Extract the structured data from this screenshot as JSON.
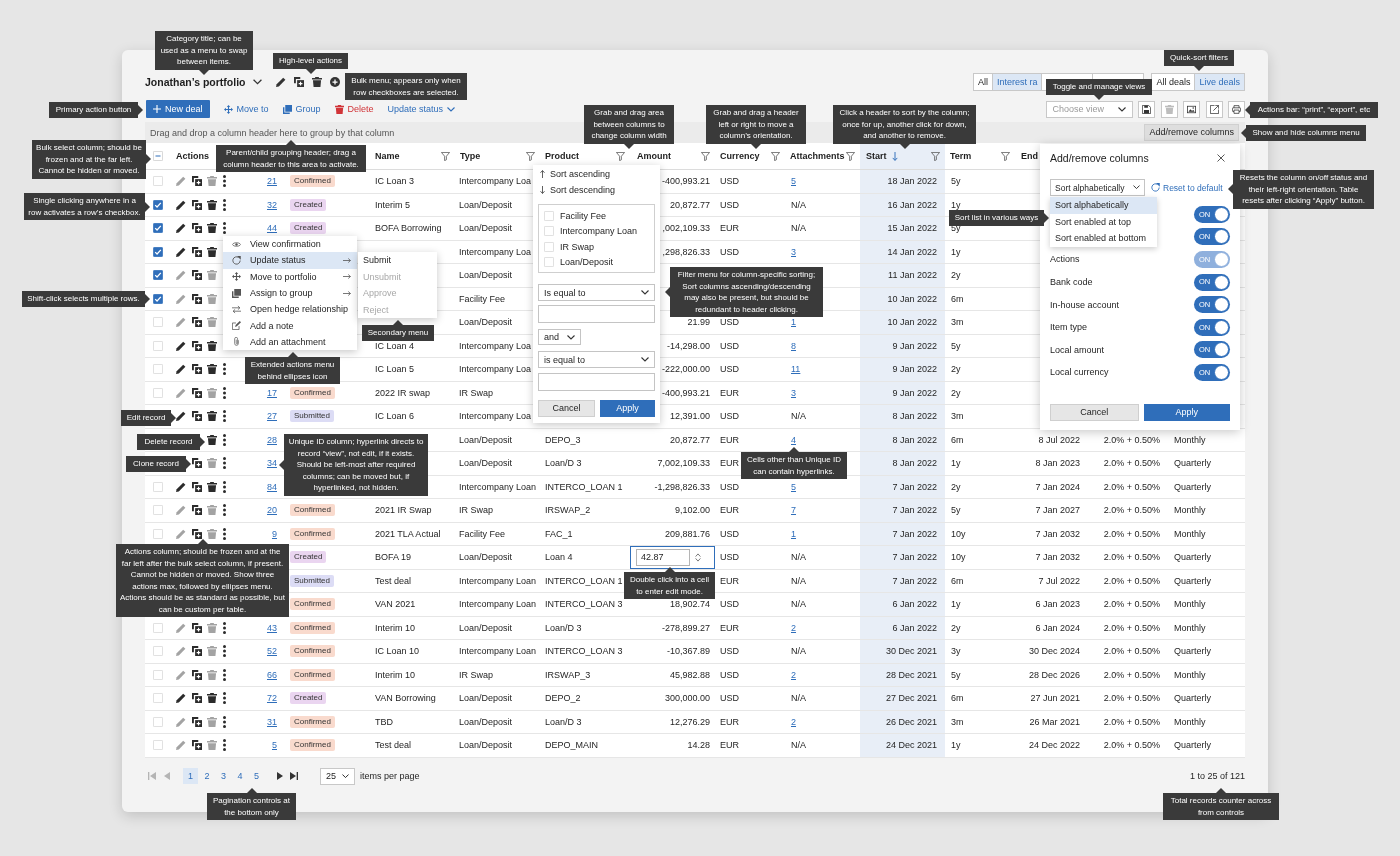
{
  "title": "Jonathan’s portfolio",
  "quick_filters": [
    {
      "segments": [
        {
          "label": "All",
          "selected": false
        },
        {
          "label": "Interest ra",
          "selected": true
        },
        {
          "selected": false
        },
        {
          "selected": false
        }
      ]
    },
    {
      "segments": [
        {
          "label": "All deals",
          "selected": false
        },
        {
          "label": "Live deals",
          "selected": true
        }
      ]
    }
  ],
  "toolbar": {
    "primary_button": "New deal",
    "bulk_actions": [
      {
        "label": "Move to",
        "kind": "move"
      },
      {
        "label": "Group",
        "kind": "group"
      },
      {
        "label": "Delete",
        "kind": "delete"
      },
      {
        "label": "Update status",
        "kind": "dropdown"
      }
    ]
  },
  "views": {
    "placeholder": "Choose view",
    "actions": [
      {
        "kind": "save",
        "disabled": false
      },
      {
        "kind": "delete",
        "disabled": true
      },
      {
        "kind": "image",
        "disabled": false
      },
      {
        "kind": "export",
        "disabled": false
      },
      {
        "kind": "print",
        "disabled": false
      }
    ]
  },
  "group_bar": {
    "hint": "Drag and drop a column header here to group by that column",
    "button": "Add/remove columns"
  },
  "table": {
    "select_all": {
      "checked": false,
      "indeterminate": true
    },
    "columns": {
      "actions": {
        "label": "Actions",
        "sorted": false
      },
      "name": {
        "label": "Name",
        "filter": true,
        "sorted": false
      },
      "type": {
        "label": "Type",
        "filter": true,
        "sorted": false
      },
      "product": {
        "label": "Product",
        "filter": true,
        "sorted": false
      },
      "amount": {
        "label": "Amount",
        "filter": true,
        "sorted": false
      },
      "currency": {
        "label": "Currency",
        "filter": true,
        "sorted": false
      },
      "attachments": {
        "label": "Attachments",
        "filter": true,
        "sorted": false
      },
      "start": {
        "label": "Start",
        "filter": true,
        "sorted": true,
        "descending": true
      },
      "term": {
        "label": "Term",
        "filter": true,
        "sorted": false
      },
      "end": {
        "label": "End",
        "sorted": false
      }
    },
    "rows": [
      {
        "checked": false,
        "locked": true,
        "actions": [
          {
            "kind": "edit"
          },
          {
            "kind": "clone"
          },
          {
            "kind": "delete"
          },
          {
            "kind": "more"
          }
        ],
        "column_3": "21",
        "column_4": {
          "label": "Confirmed",
          "color": "#f9dacd"
        },
        "name": "IC Loan 3",
        "type": "Intercompany Loa",
        "amount": "-400,993.21",
        "editing": false,
        "currency": "USD",
        "attachments": "5",
        "attachments_link": true,
        "start": "18 Jan 2022",
        "term": "5y"
      },
      {
        "checked": true,
        "locked": false,
        "actions": [
          {
            "kind": "edit"
          },
          {
            "kind": "clone"
          },
          {
            "kind": "delete"
          },
          {
            "kind": "more"
          }
        ],
        "column_3": "32",
        "column_4": {
          "label": "Created",
          "color": "#ead5f0"
        },
        "name": "Interim 5",
        "type": "Loan/Deposit",
        "amount": "20,872.77",
        "editing": false,
        "currency": "USD",
        "attachments": "N/A",
        "attachments_link": false,
        "start": "16 Jan 2022",
        "term": "1y"
      },
      {
        "checked": true,
        "locked": false,
        "actions": [
          {
            "kind": "edit"
          },
          {
            "kind": "clone"
          },
          {
            "kind": "delete"
          },
          {
            "kind": "more"
          }
        ],
        "column_3": "44",
        "column_4": {
          "label": "Created",
          "color": "#ead5f0"
        },
        "name": "BOFA Borrowing",
        "type": "Loan/Deposit",
        "amount": ",002,109.33",
        "editing": false,
        "currency": "EUR",
        "attachments": "N/A",
        "attachments_link": false,
        "start": "15 Jan 2022",
        "term": "5y"
      },
      {
        "checked": true,
        "locked": false,
        "actions": [
          {
            "kind": "edit"
          },
          {
            "kind": "clone"
          },
          {
            "kind": "delete"
          }
        ],
        "type": "Intercompany Loa",
        "amount": ",298,826.33",
        "editing": false,
        "currency": "USD",
        "attachments": "3",
        "attachments_link": true,
        "start": "14 Jan 2022",
        "term": "1y"
      },
      {
        "checked": true,
        "locked": true,
        "actions": [
          {
            "kind": "edit"
          },
          {
            "kind": "clone"
          },
          {
            "kind": "delete"
          }
        ],
        "type": "Loan/Deposit",
        "editing": false,
        "start": "11 Jan 2022",
        "term": "2y"
      },
      {
        "checked": true,
        "locked": true,
        "actions": [
          {
            "kind": "edit"
          },
          {
            "kind": "clone"
          },
          {
            "kind": "delete"
          }
        ],
        "type": "Facility Fee",
        "editing": false,
        "start": "10 Jan 2022",
        "term": "6m"
      },
      {
        "checked": false,
        "locked": true,
        "actions": [
          {
            "kind": "edit"
          },
          {
            "kind": "clone"
          },
          {
            "kind": "delete"
          }
        ],
        "type": "Loan/Deposit",
        "amount": "21.99",
        "editing": false,
        "currency": "USD",
        "attachments": "1",
        "attachments_link": true,
        "start": "10 Jan 2022",
        "term": "3m"
      },
      {
        "checked": false,
        "locked": false,
        "actions": [
          {
            "kind": "edit"
          },
          {
            "kind": "clone"
          },
          {
            "kind": "delete"
          }
        ],
        "name": "IC Loan 4",
        "type": "Intercompany Loa",
        "amount": "-14,298.00",
        "editing": false,
        "currency": "USD",
        "attachments": "8",
        "attachments_link": true,
        "start": "9 Jan 2022",
        "term": "5y"
      },
      {
        "checked": false,
        "locked": false,
        "actions": [
          {
            "kind": "edit"
          },
          {
            "kind": "clone"
          },
          {
            "kind": "delete"
          },
          {
            "kind": "more"
          }
        ],
        "name": "IC Loan 5",
        "type": "Intercompany Loa",
        "amount": "-222,000.00",
        "editing": false,
        "currency": "USD",
        "attachments": "11",
        "attachments_link": true,
        "start": "9 Jan 2022",
        "term": "2y"
      },
      {
        "checked": false,
        "locked": true,
        "actions": [
          {
            "kind": "edit"
          },
          {
            "kind": "clone"
          },
          {
            "kind": "delete"
          },
          {
            "kind": "more"
          }
        ],
        "column_3": "17",
        "column_4": {
          "label": "Confirmed",
          "color": "#f9dacd"
        },
        "name": "2022 IR swap",
        "type": "IR Swap",
        "amount": "-400,993.21",
        "editing": false,
        "currency": "EUR",
        "attachments": "3",
        "attachments_link": true,
        "start": "9 Jan 2022",
        "term": "2y"
      },
      {
        "locked": false,
        "actions": [
          {
            "kind": "edit"
          },
          {
            "kind": "clone"
          },
          {
            "kind": "delete"
          },
          {
            "kind": "more"
          }
        ],
        "column_3": "27",
        "column_4": {
          "label": "Submitted",
          "color": "#dcdcf5"
        },
        "name": "IC Loan 6",
        "type": "Intercompany Loa",
        "amount": "12,391.00",
        "editing": false,
        "currency": "USD",
        "attachments": "N/A",
        "attachments_link": false,
        "start": "8 Jan 2022",
        "term": "3m"
      },
      {
        "locked": false,
        "actions": [
          {
            "kind": "delete"
          },
          {
            "kind": "more"
          }
        ],
        "column_3": "28",
        "type": "Loan/Deposit",
        "product": "DEPO_3",
        "amount": "20,872.77",
        "editing": false,
        "currency": "EUR",
        "attachments": "4",
        "attachments_link": true,
        "start": "8 Jan 2022",
        "term": "6m",
        "end": "8 Jul 2022",
        "column_14": "2.0% + 0.50%",
        "column_15": "Monthly"
      },
      {
        "locked": true,
        "actions": [
          {
            "kind": "clone"
          },
          {
            "kind": "delete"
          },
          {
            "kind": "more"
          }
        ],
        "column_3": "34",
        "type": "Loan/Deposit",
        "product": "Loan/D 3",
        "amount": "7,002,109.33",
        "editing": false,
        "currency": "EUR",
        "start": "8 Jan 2022",
        "term": "1y",
        "end": "8 Jan 2023",
        "column_14": "2.0% + 0.50%",
        "column_15": "Quarterly"
      },
      {
        "checked": false,
        "locked": false,
        "actions": [
          {
            "kind": "edit"
          },
          {
            "kind": "clone"
          },
          {
            "kind": "delete"
          },
          {
            "kind": "more"
          }
        ],
        "column_3": "84",
        "type": "Intercompany Loan",
        "product": "INTERCO_LOAN 1",
        "amount": "-1,298,826.33",
        "editing": false,
        "currency": "USD",
        "attachments": "5",
        "attachments_link": true,
        "start": "7 Jan 2022",
        "term": "2y",
        "end": "7 Jan 2024",
        "column_14": "2.0% + 0.50%",
        "column_15": "Quarterly"
      },
      {
        "checked": false,
        "locked": true,
        "actions": [
          {
            "kind": "edit"
          },
          {
            "kind": "clone"
          },
          {
            "kind": "delete"
          },
          {
            "kind": "more"
          }
        ],
        "column_3": "20",
        "column_4": {
          "label": "Confirmed",
          "color": "#f9dacd"
        },
        "name": "2021 IR Swap",
        "type": "IR Swap",
        "product": "IRSWAP_2",
        "amount": "9,102.00",
        "editing": false,
        "currency": "EUR",
        "attachments": "7",
        "attachments_link": true,
        "start": "7 Jan 2022",
        "term": "5y",
        "end": "7 Jan 2027",
        "column_14": "2.0% + 0.50%",
        "column_15": "Monthly"
      },
      {
        "checked": false,
        "locked": true,
        "actions": [
          {
            "kind": "edit"
          },
          {
            "kind": "clone"
          },
          {
            "kind": "delete"
          },
          {
            "kind": "more"
          }
        ],
        "column_3": "9",
        "column_4": {
          "label": "Confirmed",
          "color": "#f9dacd"
        },
        "name": "2021 TLA Actual",
        "type": "Facility Fee",
        "product": "FAC_1",
        "amount": "209,881.76",
        "editing": false,
        "currency": "USD",
        "attachments": "1",
        "attachments_link": true,
        "start": "7 Jan 2022",
        "term": "10y",
        "end": "7 Jan 2032",
        "column_14": "2.0% + 0.50%",
        "column_15": "Monthly"
      },
      {
        "column_4": {
          "label": "Created",
          "color": "#ead5f0"
        },
        "name": "BOFA 19",
        "type": "Loan/Deposit",
        "product": "Loan 4",
        "amount": "42.87",
        "editing": true,
        "currency": "USD",
        "attachments": "N/A",
        "attachments_link": false,
        "start": "7 Jan 2022",
        "term": "10y",
        "end": "7 Jan 2032",
        "column_14": "2.0% + 0.50%",
        "column_15": "Quarterly"
      },
      {
        "column_4": {
          "label": "Submitted",
          "color": "#dcdcf5"
        },
        "name": "Test deal",
        "type": "Intercompany Loan",
        "product": "INTERCO_LOAN 1",
        "editing": false,
        "currency": "EUR",
        "attachments": "N/A",
        "attachments_link": false,
        "start": "7 Jan 2022",
        "term": "6m",
        "end": "7 Jul 2022",
        "column_14": "2.0% + 0.50%",
        "column_15": "Quarterly"
      },
      {
        "column_4": {
          "label": "Confirmed",
          "color": "#f9dacd"
        },
        "name": "VAN 2021",
        "type": "Intercompany Loan",
        "product": "INTERCO_LOAN 3",
        "amount": "18,902.74",
        "editing": false,
        "currency": "USD",
        "attachments": "N/A",
        "attachments_link": false,
        "start": "6 Jan 2022",
        "term": "1y",
        "end": "6 Jan 2023",
        "column_14": "2.0% + 0.50%",
        "column_15": "Monthly"
      },
      {
        "checked": false,
        "locked": true,
        "actions": [
          {
            "kind": "edit"
          },
          {
            "kind": "clone"
          },
          {
            "kind": "delete"
          },
          {
            "kind": "more"
          }
        ],
        "column_3": "43",
        "column_4": {
          "label": "Confirmed",
          "color": "#f9dacd"
        },
        "name": "Interim 10",
        "type": "Loan/Deposit",
        "product": "Loan/D 3",
        "amount": "-278,899.27",
        "editing": false,
        "currency": "EUR",
        "attachments": "2",
        "attachments_link": true,
        "start": "6 Jan 2022",
        "term": "2y",
        "end": "6 Jan 2024",
        "column_14": "2.0% + 0.50%",
        "column_15": "Monthly"
      },
      {
        "checked": false,
        "locked": true,
        "actions": [
          {
            "kind": "edit"
          },
          {
            "kind": "clone"
          },
          {
            "kind": "delete"
          },
          {
            "kind": "more"
          }
        ],
        "column_3": "52",
        "column_4": {
          "label": "Confirmed",
          "color": "#f9dacd"
        },
        "name": "IC Loan 10",
        "type": "Intercompany Loan",
        "product": "INTERCO_LOAN 3",
        "amount": "-10,367.89",
        "editing": false,
        "currency": "USD",
        "attachments": "N/A",
        "attachments_link": false,
        "start": "30 Dec 2021",
        "term": "3y",
        "end": "30 Dec 2024",
        "column_14": "2.0% + 0.50%",
        "column_15": "Quarterly"
      },
      {
        "checked": false,
        "locked": true,
        "actions": [
          {
            "kind": "edit"
          },
          {
            "kind": "clone"
          },
          {
            "kind": "delete"
          },
          {
            "kind": "more"
          }
        ],
        "column_3": "66",
        "column_4": {
          "label": "Confirmed",
          "color": "#f9dacd"
        },
        "name": "Interim 10",
        "type": "IR Swap",
        "product": "IRSWAP_3",
        "amount": "45,982.88",
        "editing": false,
        "currency": "USD",
        "attachments": "2",
        "attachments_link": true,
        "start": "28 Dec 2021",
        "term": "5y",
        "end": "28 Dec 2026",
        "column_14": "2.0% + 0.50%",
        "column_15": "Monthly"
      },
      {
        "checked": false,
        "locked": false,
        "actions": [
          {
            "kind": "edit"
          },
          {
            "kind": "clone"
          },
          {
            "kind": "delete"
          },
          {
            "kind": "more"
          }
        ],
        "column_3": "72",
        "column_4": {
          "label": "Created",
          "color": "#ead5f0"
        },
        "name": "VAN Borrowing",
        "type": "Loan/Deposit",
        "product": "DEPO_2",
        "amount": "300,000.00",
        "editing": false,
        "currency": "USD",
        "attachments": "N/A",
        "attachments_link": false,
        "start": "27 Dec 2021",
        "term": "6m",
        "end": "27 Jun 2021",
        "column_14": "2.0% + 0.50%",
        "column_15": "Quarterly"
      },
      {
        "checked": false,
        "locked": true,
        "actions": [
          {
            "kind": "edit"
          },
          {
            "kind": "clone"
          },
          {
            "kind": "delete"
          },
          {
            "kind": "more"
          }
        ],
        "column_3": "31",
        "column_4": {
          "label": "Confirmed",
          "color": "#f9dacd"
        },
        "name": "TBD",
        "type": "Loan/Deposit",
        "product": "Loan/D 3",
        "amount": "12,276.29",
        "editing": false,
        "currency": "EUR",
        "attachments": "2",
        "attachments_link": true,
        "start": "26 Dec 2021",
        "term": "3m",
        "end": "26 Mar 2021",
        "column_14": "2.0% + 0.50%",
        "column_15": "Monthly"
      },
      {
        "checked": false,
        "locked": true,
        "actions": [
          {
            "kind": "edit"
          },
          {
            "kind": "clone"
          },
          {
            "kind": "delete"
          },
          {
            "kind": "more"
          }
        ],
        "column_3": "5",
        "column_4": {
          "label": "Confirmed",
          "color": "#f9dacd"
        },
        "name": "Test deal",
        "type": "Loan/Deposit",
        "product": "DEPO_MAIN",
        "amount": "14.28",
        "editing": false,
        "currency": "EUR",
        "attachments": "N/A",
        "attachments_link": false,
        "start": "24 Dec 2021",
        "term": "1y",
        "end": "24 Dec 2022",
        "column_14": "2.0% + 0.50%",
        "column_15": "Quarterly"
      }
    ]
  },
  "row_menu": {
    "items": [
      {
        "label": "View confirmation",
        "kind": "view",
        "submenu": false,
        "selected": false
      },
      {
        "label": "Update status",
        "kind": "status",
        "submenu": true,
        "selected": true
      },
      {
        "label": "Move to portfolio",
        "kind": "move",
        "submenu": true,
        "selected": false
      },
      {
        "label": "Assign to group",
        "kind": "group",
        "submenu": true,
        "selected": false
      },
      {
        "label": "Open hedge relationship",
        "kind": "hedge",
        "submenu": false,
        "selected": false
      },
      {
        "label": "Add a note",
        "kind": "note",
        "submenu": false,
        "selected": false
      },
      {
        "label": "Add an attachment",
        "kind": "attach",
        "submenu": false,
        "selected": false
      }
    ]
  },
  "status_submenu": {
    "items": [
      {
        "label": "Submit",
        "disabled": false
      },
      {
        "label": "Unsubmit",
        "disabled": true
      },
      {
        "label": "Approve",
        "disabled": true
      },
      {
        "label": "Reject",
        "disabled": true
      }
    ]
  },
  "filter_menu": {
    "sort_options": [
      {
        "label": "Sort ascending",
        "kind": "ascending"
      },
      {
        "label": "Sort descending",
        "kind": "descending"
      }
    ],
    "values": [
      {
        "label": "Facility Fee",
        "checked": false
      },
      {
        "label": "Intercompany Loan",
        "checked": false
      },
      {
        "label": "IR Swap",
        "checked": false
      },
      {
        "label": "Loan/Deposit",
        "checked": false
      }
    ],
    "condition_1": "Is equal to",
    "join": "and",
    "condition_2": "is equal to",
    "cancel": "Cancel",
    "apply": "Apply"
  },
  "columns_panel": {
    "title": "Add/remove columns",
    "sort_select": "Sort alphabetically",
    "reset": "Reset to default",
    "sort_options": [
      {
        "label": "Sort alphabetically",
        "selected": true
      },
      {
        "label": "Sort enabled at top",
        "selected": false
      },
      {
        "label": "Sort enabled at bottom",
        "selected": false
      }
    ],
    "columns": [
      {
        "on": true,
        "disabled": false,
        "switch_text": "ON"
      },
      {
        "on": true,
        "disabled": false,
        "switch_text": "ON"
      },
      {
        "label": "Actions",
        "on": true,
        "disabled": true,
        "switch_text": "ON"
      },
      {
        "label": "Bank code",
        "on": true,
        "disabled": false,
        "switch_text": "ON"
      },
      {
        "label": "In-house account",
        "on": true,
        "disabled": false,
        "switch_text": "ON"
      },
      {
        "label": "Item type",
        "on": true,
        "disabled": false,
        "switch_text": "ON"
      },
      {
        "label": "Local amount",
        "on": true,
        "disabled": false,
        "switch_text": "ON"
      },
      {
        "label": "Local currency",
        "on": true,
        "disabled": false,
        "switch_text": "ON"
      }
    ],
    "cancel": "Cancel",
    "apply": "Apply"
  },
  "pagination": {
    "nav_start": [
      {
        "kind": "first",
        "disabled": true
      },
      {
        "kind": "previous",
        "disabled": true
      }
    ],
    "pages": [
      {
        "label": "1",
        "selected": true
      },
      {
        "label": "2",
        "selected": false
      },
      {
        "label": "3",
        "selected": false
      },
      {
        "label": "4",
        "selected": false
      },
      {
        "label": "5",
        "selected": false
      }
    ],
    "nav_end": [
      {
        "kind": "next",
        "disabled": false
      },
      {
        "kind": "last",
        "disabled": false
      }
    ],
    "page_size": "25",
    "page_size_label": "items per page",
    "count": "1 to 25 of 121"
  },
  "annotations": [
    "Category title; can be used as a menu to swap between items.",
    "High-level actions",
    "Bulk menu; appears only when row checkboxes are selected.",
    "Primary action button",
    "Quick-sort filters",
    "Toggle and manage views",
    "Actions bar: “print”, “export”, etc",
    "Grab and drag area between columns to change column width",
    "Grab and drag a header left or right to move a column’s orientation.",
    "Click a header to sort by the column; once for up, another click for down, and another to remove.",
    "Show and hide columns menu",
    "Bulk select column; should be frozen and at the far left. Cannot be hidden or moved.",
    "Parent/child grouping header; drag a column header to this area to activate.",
    "Resets the column on/off status and their left-right orientation. Table resets after clicking “Apply” button.",
    "Single clicking anywhere in a row activates a row’s checkbox.",
    "Sort list in various ways",
    "Filter menu for column-specific sorting; Sort columns ascending/descending may also be present, but should be redundant to header clicking.",
    "Shift-click selects multiple rows.",
    "Secondary menu",
    "Extended actions menu behind ellipses icon",
    "Edit record",
    "Delete record",
    "Clone record",
    "Unique ID column; hyperlink directs to record “view”, not edit, if it exists. Should be left-most after required columns; can be moved but, if hyperlinked, not hidden.",
    "Cells other than Unique ID can contain hyperlinks.",
    "Actions column; should be frozen and at the far left after the bulk select column, if present. Cannot be hidden or moved. Show three actions max, followed by ellipses menu. Actions should be as standard as possible, but can be custom per table.",
    "Double click into a cell to enter edit mode.",
    "Pagination controls at the bottom only",
    "Total records counter across from controls"
  ]
}
